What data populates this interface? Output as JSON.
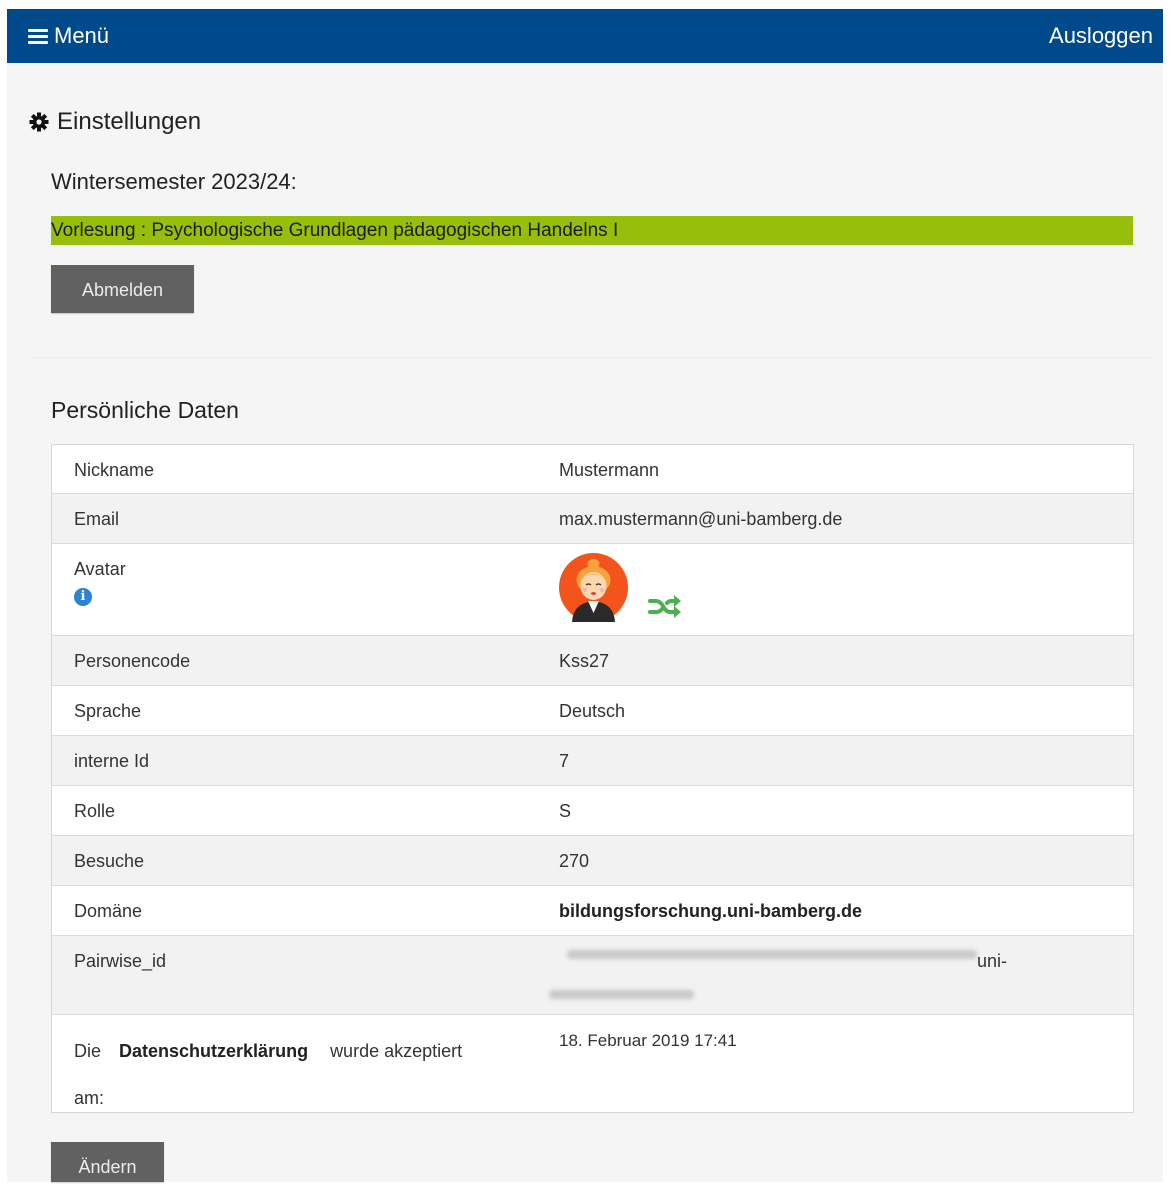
{
  "navbar": {
    "menu_label": "Menü",
    "logout_label": "Ausloggen"
  },
  "page": {
    "title": "Einstellungen",
    "semester": "Wintersemester 2023/24:",
    "course": "Vorlesung : Psychologische Grundlagen pädagogischen Handelns I",
    "unsubscribe_label": "Abmelden"
  },
  "personal": {
    "title": "Persönliche Daten",
    "rows": [
      {
        "label": "Nickname",
        "value": "Mustermann"
      },
      {
        "label": "Email",
        "value": "max.mustermann@uni-bamberg.de"
      },
      {
        "label": "Avatar",
        "value": ""
      },
      {
        "label": "Personencode",
        "value": "Kss27"
      },
      {
        "label": "Sprache",
        "value": "Deutsch"
      },
      {
        "label": "interne Id",
        "value": "7"
      },
      {
        "label": "Rolle",
        "value": "S"
      },
      {
        "label": "Besuche",
        "value": "270"
      },
      {
        "label": "Domäne",
        "value": "bildungsforschung.uni-bamberg.de"
      },
      {
        "label": "Pairwise_id",
        "value": "uni-"
      }
    ],
    "privacy": {
      "prefix": "Die",
      "link": "Datenschutzerklärung",
      "suffix": "wurde akzeptiert",
      "am": "am:",
      "date": "18. Februar 2019 17:41"
    }
  },
  "buttons": {
    "change_label": "Ändern"
  },
  "colors": {
    "navbar": "#004a8c",
    "course_highlight": "#96be0a",
    "button": "#616161",
    "info_icon": "#2b83d5",
    "shuffle_icon": "#4caf50"
  },
  "icons": {
    "menu": "hamburger-icon",
    "settings": "gear-icon",
    "info": "info-icon",
    "shuffle": "shuffle-icon"
  }
}
